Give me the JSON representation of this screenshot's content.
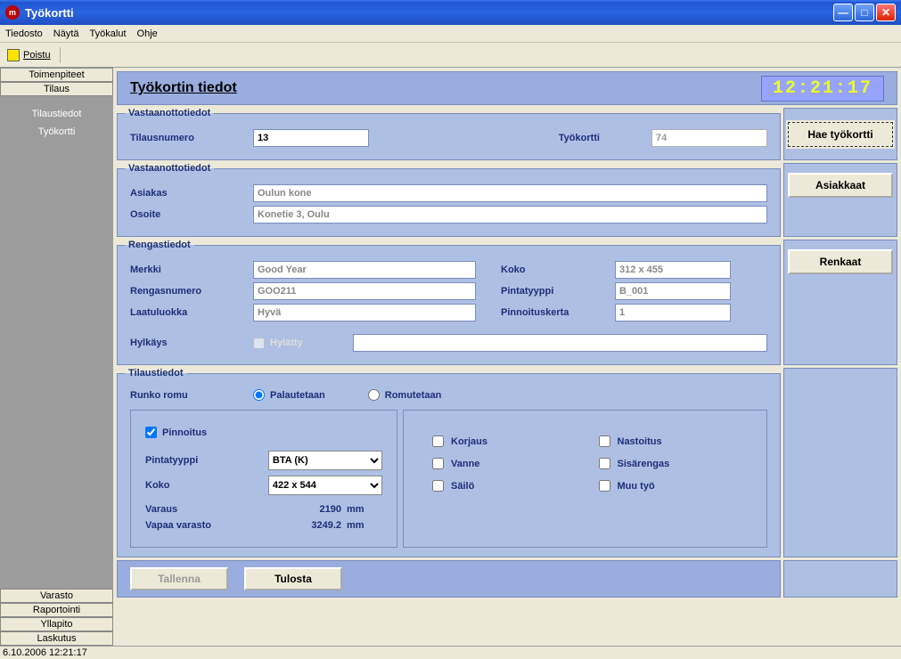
{
  "window": {
    "title": "Työkortti"
  },
  "menus": {
    "file": "Tiedosto",
    "view": "Näytä",
    "tools": "Työkalut",
    "help": "Ohje"
  },
  "toolbar": {
    "exit": "Poistu"
  },
  "sidebar": {
    "top": [
      "Toimenpiteet",
      "Tilaus"
    ],
    "links": [
      "Tilaustiedot",
      "Työkortti"
    ],
    "bottom": [
      "Varasto",
      "Raportointi",
      "Yllapito",
      "Laskutus"
    ]
  },
  "header": {
    "title": "Työkortin tiedot",
    "clock": "12:21:17"
  },
  "section1": {
    "legend": "Vastaanottotiedot",
    "order_label": "Tilausnumero",
    "order_value": "13",
    "card_label": "Työkortti",
    "card_value": "74",
    "fetch_button": "Hae työkortti"
  },
  "section2": {
    "legend": "Vastaanottotiedot",
    "customer_label": "Asiakas",
    "customer_value": "Oulun kone",
    "address_label": "Osoite",
    "address_value": "Konetie 3, Oulu",
    "customers_button": "Asiakkaat"
  },
  "section3": {
    "legend": "Rengastiedot",
    "brand_label": "Merkki",
    "brand_value": "Good Year",
    "size_label": "Koko",
    "size_value": "312 x 455",
    "tireno_label": "Rengasnumero",
    "tireno_value": "GOO211",
    "tread_label": "Pintatyyppi",
    "tread_value": "B_001",
    "quality_label": "Laatuluokka",
    "quality_value": "Hyvä",
    "retread_label": "Pinnoituskerta",
    "retread_value": "1",
    "reject_label": "Hylkäys",
    "rejected_cb": "Hylätty",
    "tires_button": "Renkaat"
  },
  "section4": {
    "legend": "Tilaustiedot",
    "frame_label": "Runko romu",
    "radio_return": "Palautetaan",
    "radio_scrap": "Romutetaan",
    "retread_cb": "Pinnoitus",
    "tread_label": "Pintatyyppi",
    "tread_select": "BTA (K)",
    "size_label": "Koko",
    "size_select": "422 x 544",
    "reserved_label": "Varaus",
    "reserved_value": "2190",
    "reserved_unit": "mm",
    "free_label": "Vapaa varasto",
    "free_value": "3249.2",
    "free_unit": "mm",
    "cb_repair": "Korjaus",
    "cb_stud": "Nastoitus",
    "cb_rim": "Vanne",
    "cb_inner": "Sisärengas",
    "cb_tank": "Säilö",
    "cb_other": "Muu työ"
  },
  "footer": {
    "save": "Tallenna",
    "print": "Tulosta"
  },
  "statusbar": "6.10.2006 12:21:17"
}
